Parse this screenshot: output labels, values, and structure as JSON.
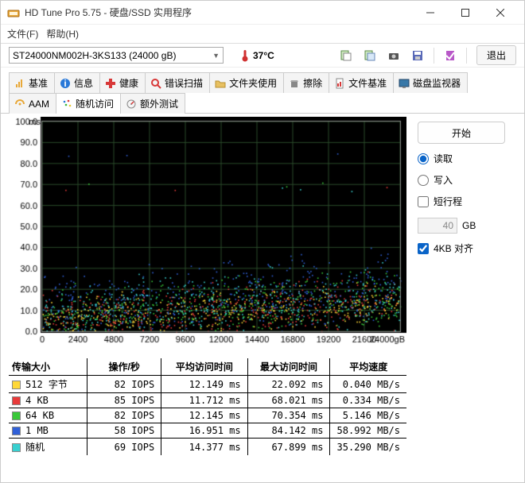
{
  "window": {
    "title": "HD Tune Pro 5.75 - 硬盘/SSD 实用程序"
  },
  "menu": {
    "file": "文件(F)",
    "help": "帮助(H)"
  },
  "toolbar": {
    "drive": "ST24000NM002H-3KS133 (24000 gB)",
    "temp": "37°C",
    "exit": "退出"
  },
  "tabs": {
    "row1": [
      "基准",
      "信息",
      "健康",
      "错误扫描",
      "文件夹使用",
      "擦除",
      "文件基准",
      "磁盘监视器"
    ],
    "row2": [
      "AAM",
      "随机访问",
      "额外测试"
    ],
    "active": "随机访问"
  },
  "side": {
    "start": "开始",
    "read": "读取",
    "write": "写入",
    "short": "短行程",
    "short_val": "40",
    "gb": "GB",
    "align": "4KB 对齐"
  },
  "table": {
    "headers": [
      "传输大小",
      "操作/秒",
      "平均访问时间",
      "最大访问时间",
      "平均速度"
    ],
    "rows": [
      {
        "color": "yellow",
        "size": "512 字节",
        "iops": "82 IOPS",
        "avg": "12.149 ms",
        "max": "22.092 ms",
        "speed": "0.040 MB/s"
      },
      {
        "color": "red",
        "size": "4 KB",
        "iops": "85 IOPS",
        "avg": "11.712 ms",
        "max": "68.021 ms",
        "speed": "0.334 MB/s"
      },
      {
        "color": "green",
        "size": "64 KB",
        "iops": "82 IOPS",
        "avg": "12.145 ms",
        "max": "70.354 ms",
        "speed": "5.146 MB/s"
      },
      {
        "color": "blue",
        "size": "1 MB",
        "iops": "58 IOPS",
        "avg": "16.951 ms",
        "max": "84.142 ms",
        "speed": "58.992 MB/s"
      },
      {
        "color": "cyan",
        "size": "随机",
        "iops": "69 IOPS",
        "avg": "14.377 ms",
        "max": "67.899 ms",
        "speed": "35.290 MB/s"
      }
    ]
  },
  "chart_data": {
    "type": "scatter",
    "xlabel": "",
    "ylabel": "ms",
    "title": "",
    "xlim": [
      0,
      24000
    ],
    "ylim": [
      0,
      100
    ],
    "xticks": [
      0,
      2400,
      4800,
      7200,
      9600,
      12000,
      14400,
      16800,
      19200,
      21600,
      24000
    ],
    "xunit_label": "24000gB",
    "yticks": [
      0,
      10,
      20,
      30,
      40,
      50,
      60,
      70,
      80,
      90,
      100
    ],
    "series": [
      {
        "name": "512 字节",
        "color": "#ffd838",
        "band": [
          3,
          22
        ],
        "trend": [
          6,
          14
        ]
      },
      {
        "name": "4 KB",
        "color": "#e83a3a",
        "band": [
          3,
          28
        ],
        "trend": [
          6,
          14
        ],
        "outliers": [
          68
        ]
      },
      {
        "name": "64 KB",
        "color": "#38c838",
        "band": [
          4,
          30
        ],
        "trend": [
          7,
          15
        ],
        "outliers": [
          70
        ]
      },
      {
        "name": "1 MB",
        "color": "#3060d8",
        "band": [
          6,
          40
        ],
        "trend": [
          10,
          22
        ],
        "outliers": [
          84
        ]
      },
      {
        "name": "随机",
        "color": "#38d0d0",
        "band": [
          4,
          32
        ],
        "trend": [
          8,
          18
        ],
        "outliers": [
          68
        ]
      }
    ],
    "note": "series band = [min_ms,max_ms] spread across x; trend = [avg_at_x0,avg_at_xMax]"
  }
}
